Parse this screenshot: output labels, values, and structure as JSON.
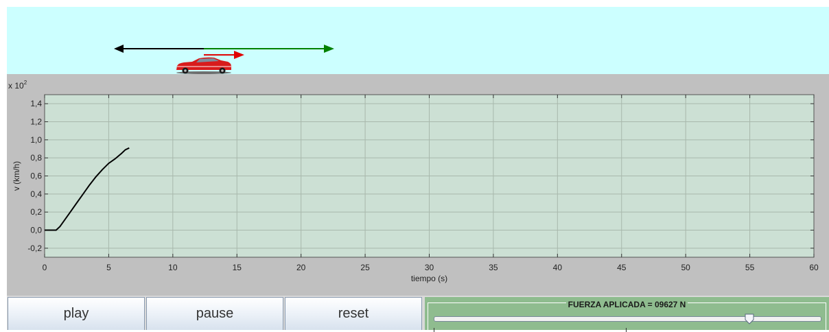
{
  "scene": {
    "car_icon": "red-car-icon",
    "sky_color": "#ccffff",
    "arrow_colors": {
      "friction": "#000000",
      "applied": "#008000",
      "acceleration": "#e00000"
    }
  },
  "chart_data": {
    "type": "line",
    "exponent_label": "x 10",
    "exponent_power": "2",
    "ylabel": "v (km/h)",
    "xlabel": "tiempo (s)",
    "xlim": [
      0,
      60
    ],
    "ylim": [
      -0.3,
      1.5
    ],
    "x_ticks": [
      0,
      5,
      10,
      15,
      20,
      25,
      30,
      35,
      40,
      45,
      50,
      55,
      60
    ],
    "x_tick_labels": [
      "0",
      "5",
      "10",
      "15",
      "20",
      "25",
      "30",
      "35",
      "40",
      "45",
      "50",
      "55",
      "60"
    ],
    "y_ticks": [
      -0.2,
      0.0,
      0.2,
      0.4,
      0.6,
      0.8,
      1.0,
      1.2,
      1.4
    ],
    "y_tick_labels": [
      "-0,2",
      "0,0",
      "0,2",
      "0,4",
      "0,6",
      "0,8",
      "1,0",
      "1,2",
      "1,4"
    ],
    "grid": true,
    "plot_background": "#cce0d4",
    "series": [
      {
        "color": "#000000",
        "x": [
          0,
          0.5,
          0.9,
          1.2,
          1.6,
          2.0,
          2.5,
          3.0,
          3.5,
          4.0,
          4.5,
          5.0,
          5.5,
          6.0,
          6.3,
          6.6
        ],
        "y": [
          0.0,
          0.0,
          0.0,
          0.04,
          0.12,
          0.2,
          0.3,
          0.4,
          0.5,
          0.59,
          0.67,
          0.74,
          0.79,
          0.85,
          0.89,
          0.91
        ]
      }
    ]
  },
  "controls": {
    "play_label": "play",
    "pause_label": "pause",
    "reset_label": "reset",
    "force_label": "FUERZA APLICADA = 09627 N",
    "force_slider_fraction": 0.82,
    "force_panel_color": "#8fbc8f"
  }
}
